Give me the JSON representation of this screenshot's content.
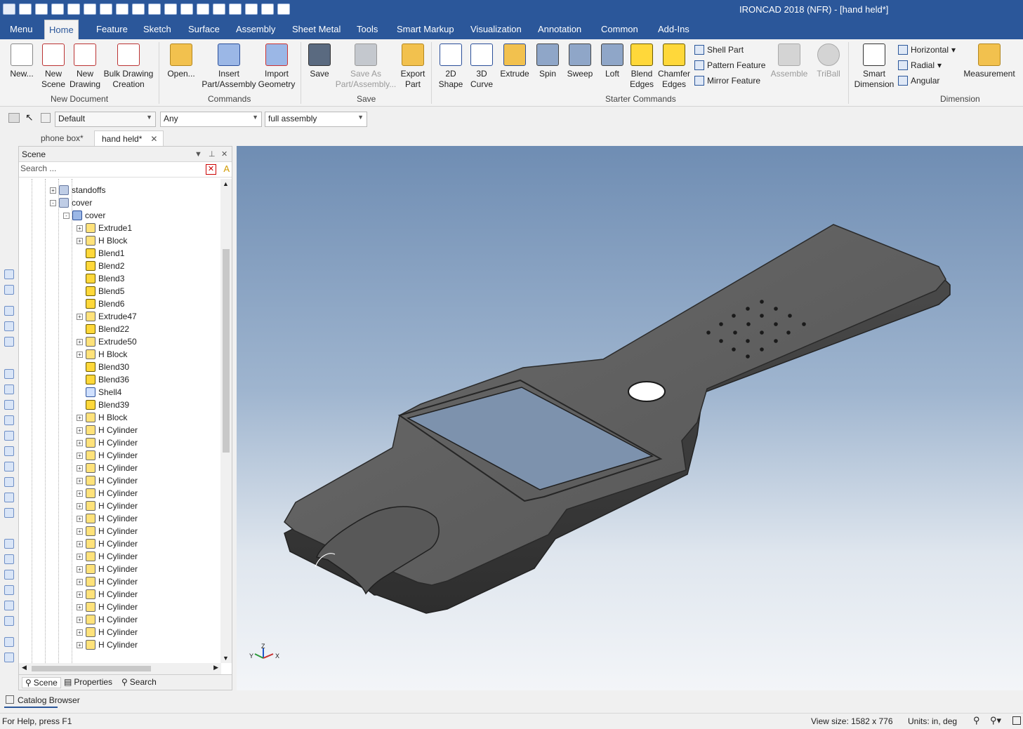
{
  "window": {
    "title": "IRONCAD 2018 (NFR) - [hand held*]"
  },
  "menu_tabs": [
    "Menu",
    "Home",
    "Feature",
    "Sketch",
    "Surface",
    "Assembly",
    "Sheet Metal",
    "Tools",
    "Smart Markup",
    "Visualization",
    "Annotation",
    "Common",
    "Add-Ins"
  ],
  "ribbon": {
    "new_document": {
      "label": "New Document",
      "new": "New...",
      "new_scene": "New\nScene",
      "new_drawing": "New\nDrawing",
      "bulk": "Bulk Drawing\nCreation"
    },
    "commands": {
      "label": "Commands",
      "open": "Open...",
      "insert": "Insert\nPart/Assembly",
      "import": "Import\nGeometry"
    },
    "save": {
      "label": "Save",
      "save": "Save",
      "save_as": "Save As\nPart/Assembly...",
      "export": "Export\nPart"
    },
    "starter": {
      "label": "Starter Commands",
      "shape2d": "2D\nShape",
      "curve3d": "3D\nCurve",
      "extrude": "Extrude",
      "spin": "Spin",
      "sweep": "Sweep",
      "loft": "Loft",
      "blend": "Blend\nEdges",
      "chamfer": "Chamfer\nEdges",
      "shell": "Shell Part",
      "pattern": "Pattern Feature",
      "mirror": "Mirror Feature",
      "assemble": "Assemble",
      "triball": "TriBall"
    },
    "dimension": {
      "label": "Dimension",
      "smart": "Smart\nDimension",
      "horizontal": "Horizontal",
      "radial": "Radial",
      "angular": "Angular",
      "measurement": "Measurement"
    }
  },
  "toolbar": {
    "style": "Default",
    "filter": "Any",
    "scope": "full assembly"
  },
  "doc_tabs": [
    "phone box*",
    "hand held*"
  ],
  "scene_panel": {
    "title": "Scene",
    "search_placeholder": "Search ...",
    "tree": [
      {
        "label": "standoffs",
        "level": 1,
        "icon": "grp",
        "exp": "+"
      },
      {
        "label": "cover",
        "level": 1,
        "icon": "grp",
        "exp": "-"
      },
      {
        "label": "cover",
        "level": 2,
        "icon": "part",
        "exp": "-"
      },
      {
        "label": "Extrude1",
        "level": 3,
        "icon": "extr",
        "exp": "+"
      },
      {
        "label": "H Block",
        "level": 3,
        "icon": "extr",
        "exp": "+"
      },
      {
        "label": "Blend1",
        "level": 3,
        "icon": "blend",
        "exp": ""
      },
      {
        "label": "Blend2",
        "level": 3,
        "icon": "blend",
        "exp": ""
      },
      {
        "label": "Blend3",
        "level": 3,
        "icon": "blend",
        "exp": ""
      },
      {
        "label": "Blend5",
        "level": 3,
        "icon": "blend",
        "exp": ""
      },
      {
        "label": "Blend6",
        "level": 3,
        "icon": "blend",
        "exp": ""
      },
      {
        "label": "Extrude47",
        "level": 3,
        "icon": "extr",
        "exp": "+"
      },
      {
        "label": "Blend22",
        "level": 3,
        "icon": "blend",
        "exp": ""
      },
      {
        "label": "Extrude50",
        "level": 3,
        "icon": "extr",
        "exp": "+"
      },
      {
        "label": "H Block",
        "level": 3,
        "icon": "extr",
        "exp": "+"
      },
      {
        "label": "Blend30",
        "level": 3,
        "icon": "blend",
        "exp": ""
      },
      {
        "label": "Blend36",
        "level": 3,
        "icon": "blend",
        "exp": ""
      },
      {
        "label": "Shell4",
        "level": 3,
        "icon": "shell",
        "exp": ""
      },
      {
        "label": "Blend39",
        "level": 3,
        "icon": "blend",
        "exp": ""
      },
      {
        "label": "H Block",
        "level": 3,
        "icon": "extr",
        "exp": "+"
      },
      {
        "label": "H Cylinder",
        "level": 3,
        "icon": "extr",
        "exp": "+"
      },
      {
        "label": "H Cylinder",
        "level": 3,
        "icon": "extr",
        "exp": "+"
      },
      {
        "label": "H Cylinder",
        "level": 3,
        "icon": "extr",
        "exp": "+"
      },
      {
        "label": "H Cylinder",
        "level": 3,
        "icon": "extr",
        "exp": "+"
      },
      {
        "label": "H Cylinder",
        "level": 3,
        "icon": "extr",
        "exp": "+"
      },
      {
        "label": "H Cylinder",
        "level": 3,
        "icon": "extr",
        "exp": "+"
      },
      {
        "label": "H Cylinder",
        "level": 3,
        "icon": "extr",
        "exp": "+"
      },
      {
        "label": "H Cylinder",
        "level": 3,
        "icon": "extr",
        "exp": "+"
      },
      {
        "label": "H Cylinder",
        "level": 3,
        "icon": "extr",
        "exp": "+"
      },
      {
        "label": "H Cylinder",
        "level": 3,
        "icon": "extr",
        "exp": "+"
      },
      {
        "label": "H Cylinder",
        "level": 3,
        "icon": "extr",
        "exp": "+"
      },
      {
        "label": "H Cylinder",
        "level": 3,
        "icon": "extr",
        "exp": "+"
      },
      {
        "label": "H Cylinder",
        "level": 3,
        "icon": "extr",
        "exp": "+"
      },
      {
        "label": "H Cylinder",
        "level": 3,
        "icon": "extr",
        "exp": "+"
      },
      {
        "label": "H Cylinder",
        "level": 3,
        "icon": "extr",
        "exp": "+"
      },
      {
        "label": "H Cylinder",
        "level": 3,
        "icon": "extr",
        "exp": "+"
      },
      {
        "label": "H Cylinder",
        "level": 3,
        "icon": "extr",
        "exp": "+"
      },
      {
        "label": "H Cylinder",
        "level": 3,
        "icon": "extr",
        "exp": "+"
      }
    ],
    "tabs": [
      "Scene",
      "Properties",
      "Search"
    ]
  },
  "catalog": "Catalog Browser",
  "status": {
    "help": "For Help, press F1",
    "view_size": "View size: 1582 x  776",
    "units": "Units: in, deg"
  },
  "axis": {
    "x": "X",
    "y": "Y",
    "z": "Z"
  },
  "colors": {
    "accent": "#2b579a",
    "model": "#555555"
  }
}
